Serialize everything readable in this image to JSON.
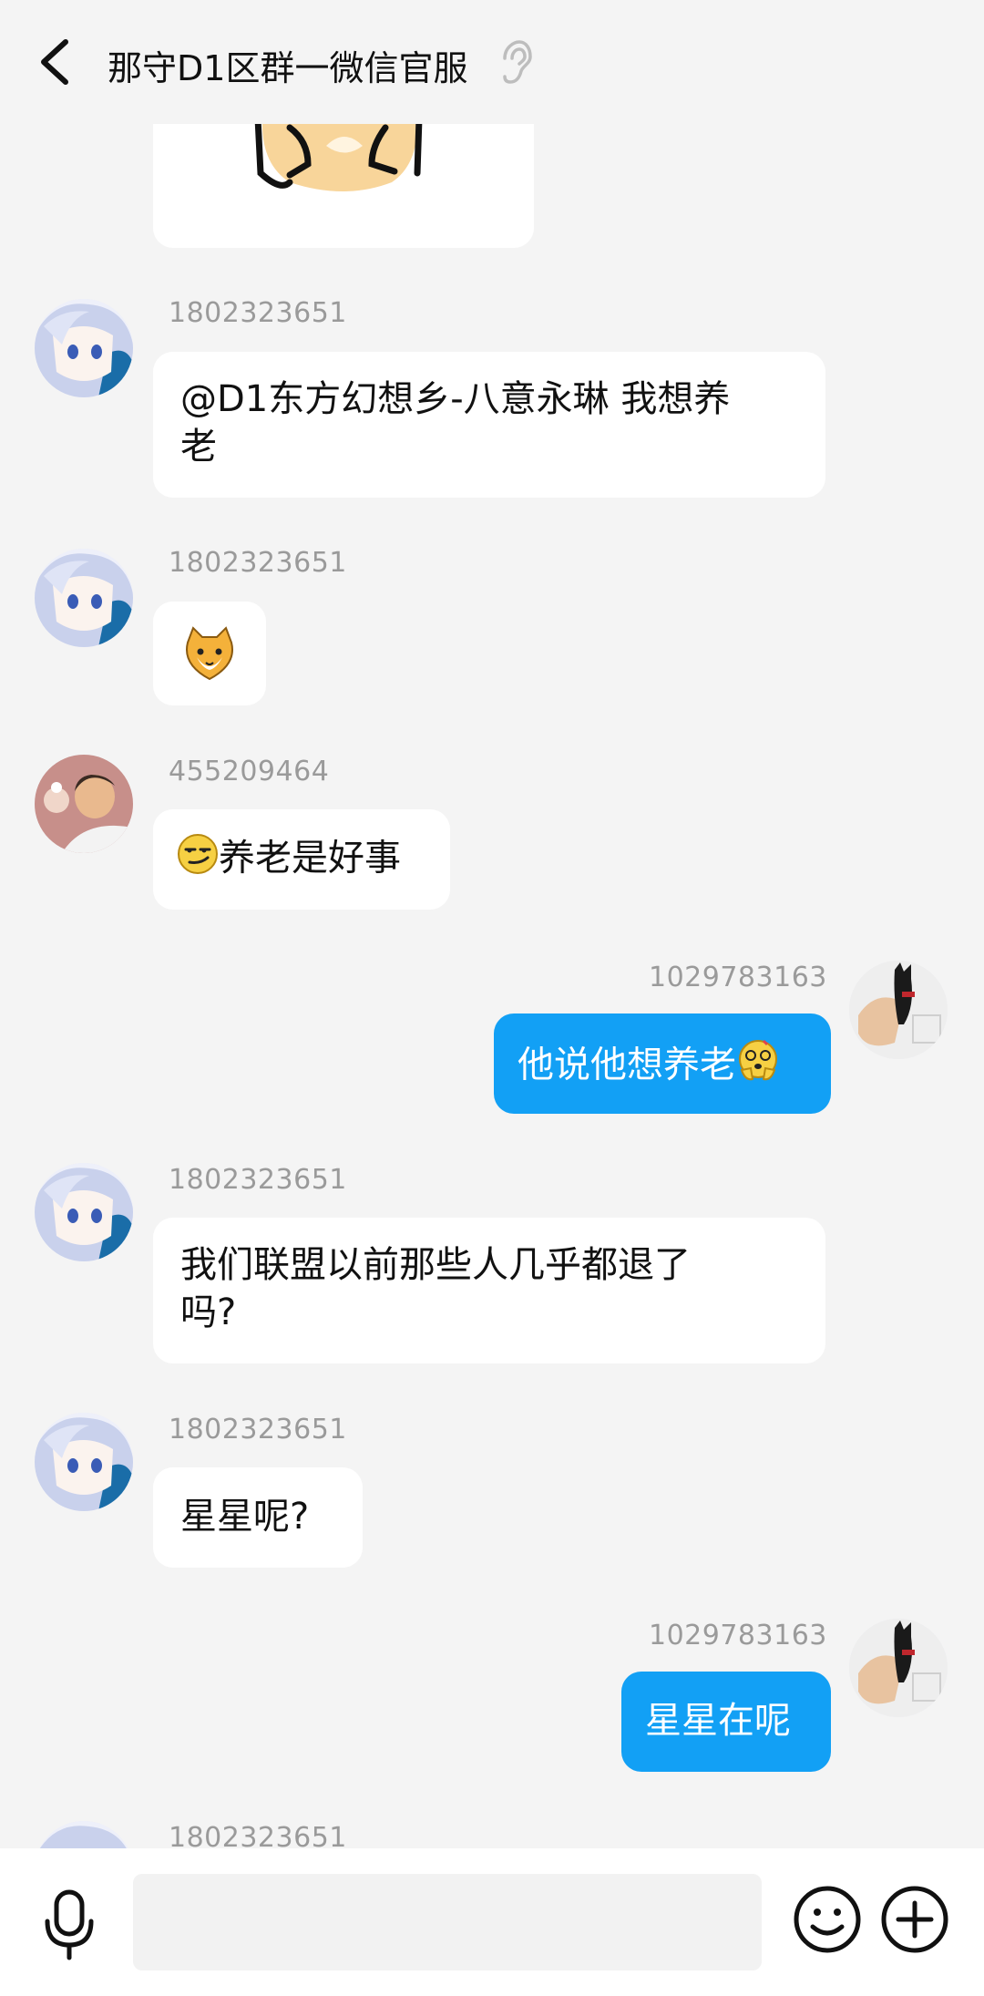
{
  "header": {
    "title": "那守D1区群一微信官服",
    "back_icon": "chevron-left-icon",
    "ear_icon": "ear-icon"
  },
  "messages": [
    {
      "id": "m0",
      "side": "left",
      "kind": "sticker-cropped",
      "sender": ""
    },
    {
      "id": "m1",
      "side": "left",
      "sender": "1802323651",
      "text_l1": "@D1东方幻想乡-八意永琳 我想养",
      "text_l2": "老"
    },
    {
      "id": "m2",
      "side": "left",
      "sender": "1802323651",
      "kind": "emoji",
      "emoji": "cat-emoji"
    },
    {
      "id": "m3",
      "side": "left",
      "sender": "455209464",
      "text": "养老是好事",
      "emoji": "smirk-emoji"
    },
    {
      "id": "m4",
      "side": "right",
      "sender": "1029783163",
      "text": "他说他想养老",
      "emoji": "dizzy-hands-emoji"
    },
    {
      "id": "m5",
      "side": "left",
      "sender": "1802323651",
      "text_l1": "我们联盟以前那些人几乎都退了",
      "text_l2": "吗?"
    },
    {
      "id": "m6",
      "side": "left",
      "sender": "1802323651",
      "text": "星星呢?"
    },
    {
      "id": "m7",
      "side": "right",
      "sender": "1029783163",
      "text": "星星在呢"
    },
    {
      "id": "m8",
      "side": "left",
      "sender": "1802323651",
      "text": ""
    }
  ],
  "input_bar": {
    "mic_icon": "microphone-icon",
    "emoji_icon": "smiley-icon",
    "plus_icon": "plus-circle-icon",
    "placeholder": ""
  },
  "colors": {
    "background": "#f4f4f4",
    "bubble_other": "#ffffff",
    "bubble_me": "#12a0f5",
    "sender_text": "#9a9a9a"
  }
}
